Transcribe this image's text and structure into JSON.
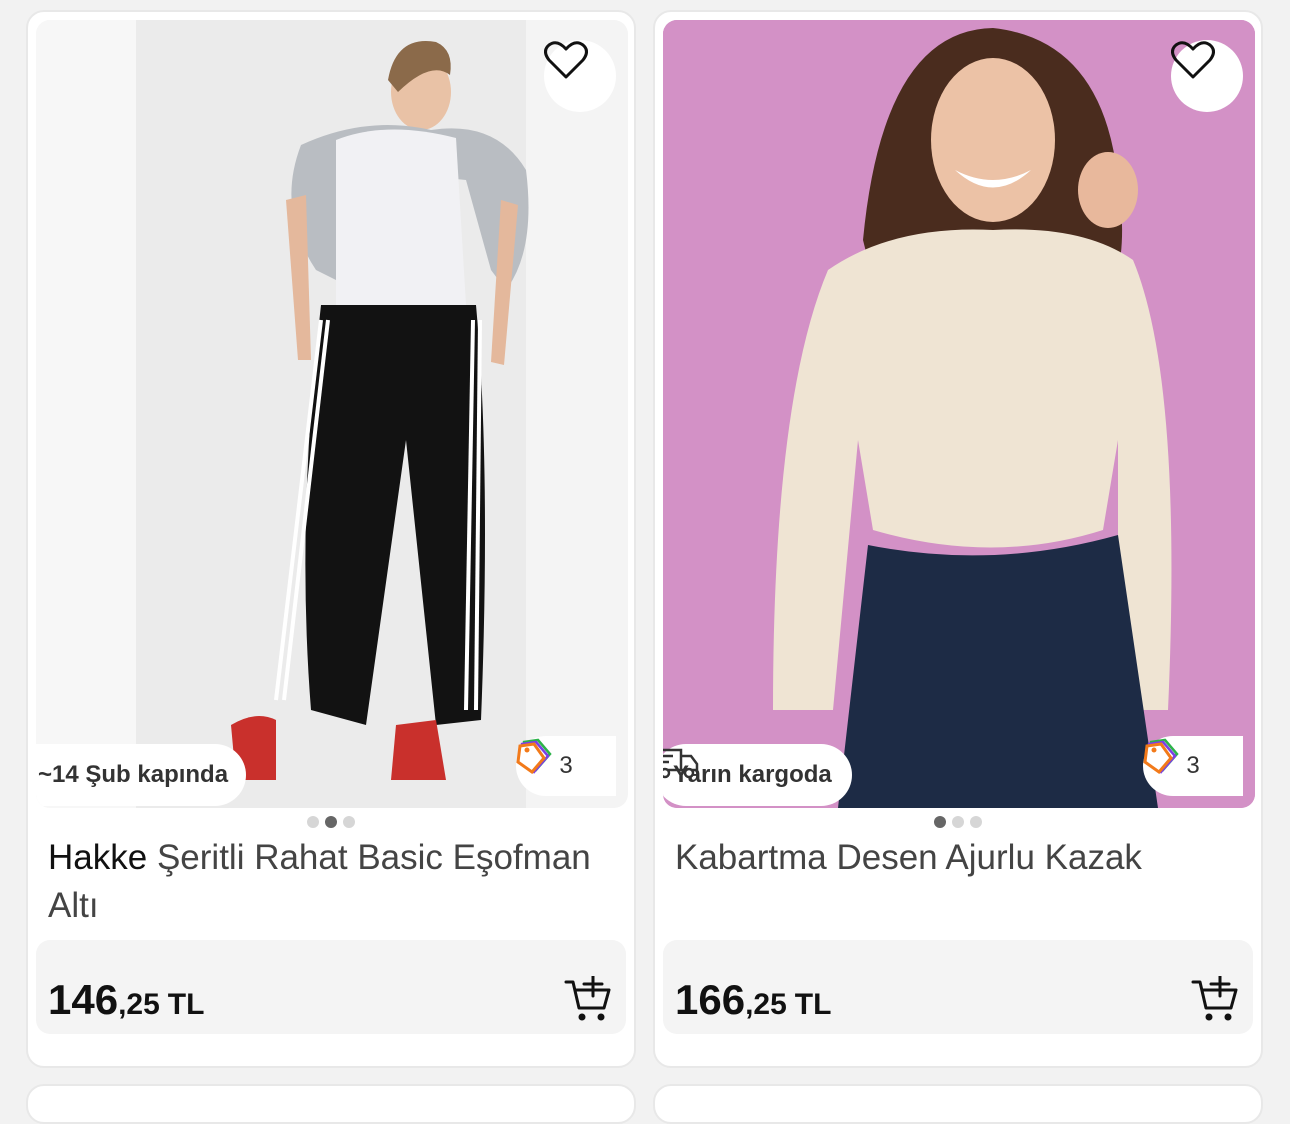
{
  "products": [
    {
      "brand": "Hakke",
      "title": "Şeritli Rahat Basic Eşofman Altı",
      "delivery": "~14 Şub kapında",
      "coupon_count": "3",
      "price_int": "146",
      "price_dec": ",25",
      "currency": "TL",
      "images_count": 3,
      "active_image": 2,
      "icons": [
        "heart-icon",
        "coupon-tag-icon",
        "add-to-cart-icon"
      ]
    },
    {
      "brand": "",
      "title": "Kabartma Desen Ajurlu Kazak",
      "delivery": "Yarın kargoda",
      "coupon_count": "3",
      "price_int": "166",
      "price_dec": ",25",
      "currency": "TL",
      "images_count": 3,
      "active_image": 1,
      "icons": [
        "heart-icon",
        "truck-icon",
        "coupon-tag-icon",
        "add-to-cart-icon"
      ]
    }
  ],
  "colors": {
    "background": "#f2f2f2",
    "card": "#ffffff",
    "price_box": "#f4f4f4",
    "coupon_orange": "#f27a1a",
    "coupon_purple": "#7b3fe4",
    "coupon_green": "#2db34a"
  }
}
